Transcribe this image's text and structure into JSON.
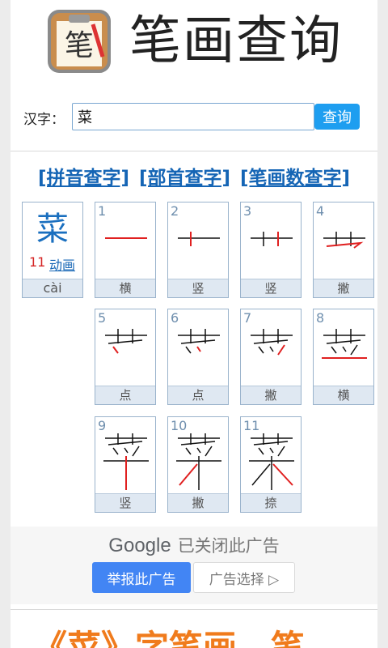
{
  "header": {
    "title": "笔画查询",
    "logo_char": "笔"
  },
  "search": {
    "label": "汉字：",
    "value": "菜",
    "button_label": "查询"
  },
  "nav": {
    "links": [
      "[拼音查字]",
      "[部首查字]",
      "[笔画数查字]"
    ]
  },
  "character": {
    "glyph": "菜",
    "stroke_count": "11",
    "animate_label": "动画",
    "pinyin": "cài"
  },
  "strokes": [
    {
      "num": "1",
      "name": "横"
    },
    {
      "num": "2",
      "name": "竖"
    },
    {
      "num": "3",
      "name": "竖"
    },
    {
      "num": "4",
      "name": "撇"
    },
    {
      "num": "5",
      "name": "点"
    },
    {
      "num": "6",
      "name": "点"
    },
    {
      "num": "7",
      "name": "撇"
    },
    {
      "num": "8",
      "name": "横"
    },
    {
      "num": "9",
      "name": "竖"
    },
    {
      "num": "10",
      "name": "撇"
    },
    {
      "num": "11",
      "name": "捺"
    }
  ],
  "ad": {
    "brand": "Google",
    "closed_text": "已关闭此广告",
    "report_label": "举报此广告",
    "choice_label": "广告选择 ▷"
  },
  "bottom": {
    "heading": "《菜》字笔画、笔"
  },
  "colors": {
    "accent": "#1e9ef0",
    "link": "#1565b5",
    "stroke_current": "#e02020",
    "heading": "#f07b1c"
  }
}
